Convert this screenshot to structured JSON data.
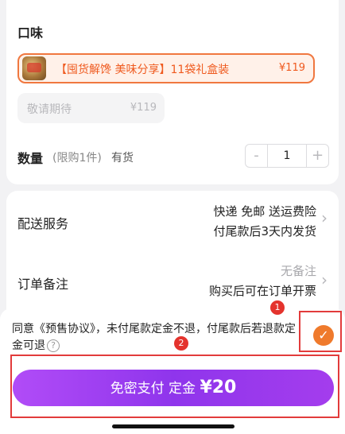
{
  "flavor": {
    "title": "口味",
    "options": [
      {
        "name": "【囤货解馋 美味分享】11袋礼盒装",
        "price": "¥119",
        "selected": true
      },
      {
        "name": "敬请期待",
        "price": "¥119",
        "selected": false
      }
    ]
  },
  "quantity": {
    "label": "数量",
    "limit": "(限购1件)",
    "stock": "有货",
    "minus": "-",
    "value": "1",
    "plus": "+"
  },
  "delivery": {
    "label": "配送服务",
    "line1": "快递 免邮 送运费险",
    "line2": "付尾款后3天内发货"
  },
  "remark": {
    "label": "订单备注",
    "line1": "无备注",
    "line2": "购买后可在订单开票"
  },
  "agreement": {
    "text": "同意《预售协议》，未付尾款定金不退，付尾款后若退款定金可退",
    "help": "?",
    "checked": true
  },
  "badges": [
    "1",
    "2"
  ],
  "pay": {
    "label": "免密支付 定金 ",
    "amount": "¥20"
  },
  "colors": {
    "accent_orange": "#ef5a1f",
    "check_orange": "#ef7a2c",
    "pay_purple": "#9b3df0",
    "highlight_red": "#e23b3b"
  }
}
